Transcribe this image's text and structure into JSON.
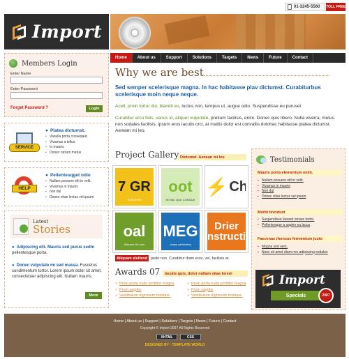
{
  "topbar": {
    "phone": "01-3245-5560",
    "toll_free": "TOLL FREE"
  },
  "header": {
    "logo_text": "Import"
  },
  "nav": {
    "items": [
      "Home",
      "About us",
      "Support",
      "Solutions",
      "Targets",
      "News",
      "Future",
      "Contact"
    ],
    "active": "Home"
  },
  "login": {
    "title": "Members Login",
    "name_label": "Enter Name",
    "password_label": "Enter Password",
    "forgot": "Forget Password ?",
    "button": "Login"
  },
  "promos": [
    {
      "badge": "SERVICE",
      "title": "Platea dictumst.",
      "items": [
        "Vanulla porta conseqaut.",
        "Vivamus a tellus",
        "In mauris",
        "Donec rutrum metus"
      ]
    },
    {
      "badge": "HELP",
      "title": "Pellentesqget odio",
      "items": [
        "Nullam posuere elit in velit.",
        "Vivamus in mauris",
        "non dui",
        "Donec vitae lectus vel ipsum"
      ]
    }
  ],
  "stories": {
    "latest": "Latest",
    "title": "Stories",
    "items": [
      {
        "lead": "Adipiscing elit. Mauris sed purus sedm",
        "rest": "pellentesque porta."
      },
      {
        "lead": "Donec vulputate mi sed massa.",
        "rest": "Fuscetus condimentum tortor. Lorem ipsum dolor sit amet, consectetuer adipiscing elit. Nullam mauris."
      }
    ],
    "more": "More"
  },
  "why": {
    "title": "Why we are best",
    "lead": "Sed semper scelerisque magna. In hac habitasse plav dictumst. Curabiturbus scelerisque moin neque neque.",
    "p1_green": "Acelt. proin tortor dui, blandit eu,",
    "p1_rest": " luctus non, tempus ut, augue odio. Suspendisse eu purusel",
    "p2_green": "Curabitur arcu felis, vanus id, aliquet vulputate,",
    "p2_rest": " pretium facilisis, enim. Donec quis libero. Nulla viverra, metus non sodales facilisis, ipsum eros iaculis orci, at mattis dolor est convallis dolohac habitasse platea dictumst. Aenean mi leo."
  },
  "gallery": {
    "title": "Project Gallery",
    "tag": "Dictumst. Aenean mi leo",
    "thumbs": [
      {
        "text": "7 GR",
        "caption": "SCELERIS"
      },
      {
        "text": "oot",
        "caption": "IN HAC QUE CONGUE"
      },
      {
        "text": "Ch",
        "caption": ""
      },
      {
        "text": "oal",
        "caption": "Aliquam elit dum"
      },
      {
        "text": "MEG",
        "caption": "neque pellentesq"
      },
      {
        "text": "Drier nstructi",
        "caption": ""
      }
    ],
    "caption_red": "Aliquam eleifend",
    "caption_rest": "pede non. Curabitur diam eros, vel, facilisis at."
  },
  "awards": {
    "title": "Awards 07",
    "tag": "Iaculis quis, dolor nullam vitae lorem",
    "left": [
      "Proin porta nulla porttitor magna",
      "Proin sagittis",
      "Vestibulum dignissim tristique."
    ],
    "right": [
      "Proin porta nulla porttitor magna",
      "Proin sagittis",
      "Vestibulum dignissim tristique."
    ]
  },
  "testimonials": {
    "title": "Testimonials",
    "groups": [
      {
        "head": "Mauris porta elementum enim.",
        "items": [
          "Nullam posuere elit in velit.",
          "Vivamus in mauris",
          "Non dui",
          "Donec vitae lectus vel ipsum"
        ]
      },
      {
        "head": "Morbi tincidunt",
        "items": [
          "Suspendisse laoreet ornare tortor.",
          "Pellentesque a sapien eu lacus"
        ]
      },
      {
        "head": "Faecenas rhoncus fermentum justo",
        "items": [
          "Magna sed sem.",
          "Nunc sit amet diam nec adipiscing sodales"
        ]
      }
    ]
  },
  "specials": {
    "logo_text": "Import",
    "bar": "Specials",
    "seal": "2007"
  },
  "footer": {
    "links": [
      "Home",
      "About us",
      "Support",
      "Solutions",
      "Targets",
      "News",
      "Future",
      "Contact"
    ],
    "copyright": "Copyright © Import 2007 All Rights Reserved",
    "badges": [
      "XHTML",
      "CSS"
    ],
    "credit": "DESIGNED BY : TEMPLATE WORLD"
  }
}
